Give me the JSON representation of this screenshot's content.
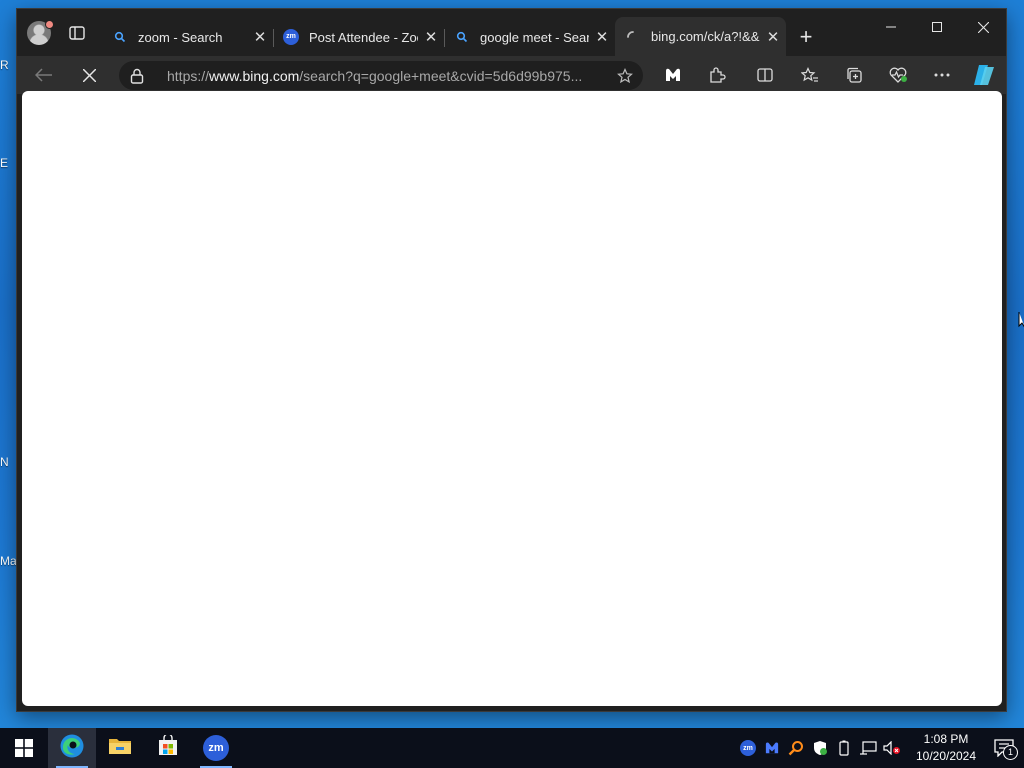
{
  "desktop": {
    "edge_letters": [
      "R",
      "E",
      "N",
      "Ma"
    ]
  },
  "browser": {
    "tabs": [
      {
        "title": "zoom - Search",
        "icon": "search-icon"
      },
      {
        "title": "Post Attendee - Zoom",
        "icon": "zoom-icon",
        "icon_text": "zm"
      },
      {
        "title": "google meet - Search",
        "icon": "search-icon"
      },
      {
        "title": "bing.com/ck/a?!&&p",
        "icon": "loading-icon",
        "active": true
      }
    ],
    "address": {
      "prefix": "https://",
      "domain": "www.bing.com",
      "path": "/search?q=google+meet&cvid=5d6d99b975..."
    },
    "window_controls": [
      "minimize",
      "maximize",
      "close"
    ]
  },
  "taskbar": {
    "apps": [
      {
        "name": "Microsoft Edge",
        "icon": "edge-icon",
        "active": true
      },
      {
        "name": "File Explorer",
        "icon": "folder-icon"
      },
      {
        "name": "Microsoft Store",
        "icon": "store-icon"
      },
      {
        "name": "Zoom",
        "icon": "zoom-icon",
        "icon_text": "zm"
      }
    ],
    "clock": {
      "time": "1:08 PM",
      "date": "10/20/2024"
    },
    "notification_count": "1"
  },
  "colors": {
    "accent": "#2d5fd9",
    "titlebar": "#202020",
    "toolbar": "#2f2f2f"
  }
}
